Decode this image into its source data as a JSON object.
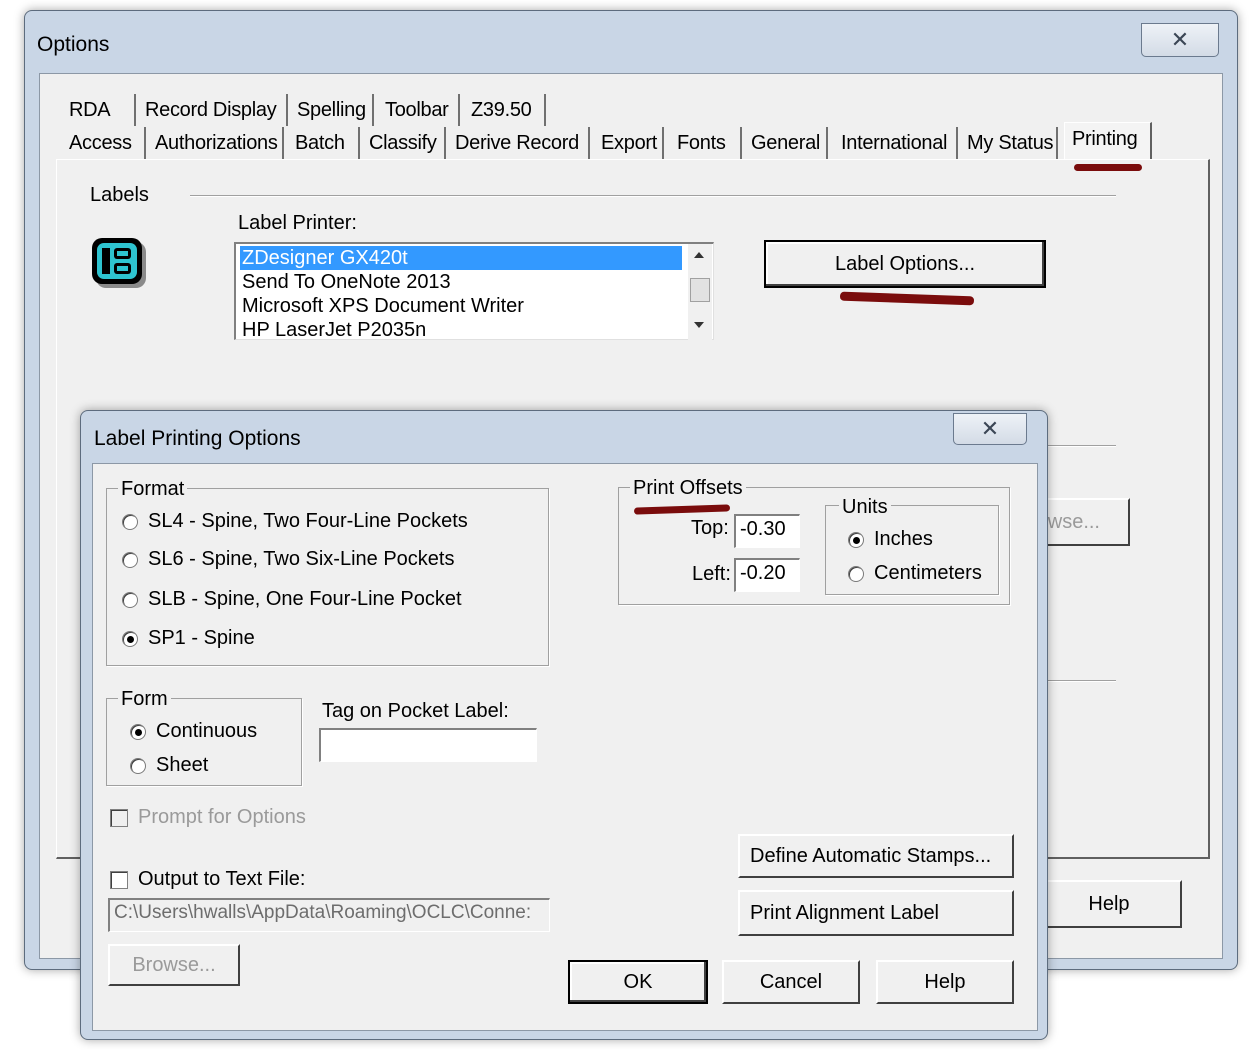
{
  "options_window": {
    "title": "Options",
    "close_glyph": "✕",
    "tabs_row1": [
      "RDA",
      "Record Display",
      "Spelling",
      "Toolbar",
      "Z39.50"
    ],
    "tabs_row2": [
      "Access",
      "Authorizations",
      "Batch",
      "Classify",
      "Derive Record",
      "Export",
      "Fonts",
      "General",
      "International",
      "My Status",
      "Printing"
    ],
    "active_tab": "Printing",
    "labels_section": "Labels",
    "label_printer_label": "Label Printer:",
    "printers": [
      "ZDesigner GX420t",
      "Send To OneNote 2013",
      "Microsoft XPS Document Writer",
      "HP LaserJet P2035n"
    ],
    "selected_printer": "ZDesigner GX420t",
    "label_options_button": "Label Options...",
    "browse_partial": "wse...",
    "help_button": "Help",
    "labels_icon": "label-printer-icon"
  },
  "label_dialog": {
    "title": "Label Printing Options",
    "close_glyph": "✕",
    "format_legend": "Format",
    "format_options": [
      "SL4 - Spine, Two Four-Line Pockets",
      "SL6 - Spine, Two Six-Line Pockets",
      "SLB - Spine, One Four-Line Pocket",
      "SP1 - Spine"
    ],
    "format_selected": "SP1 - Spine",
    "form_legend": "Form",
    "form_options": [
      "Continuous",
      "Sheet"
    ],
    "form_selected": "Continuous",
    "tag_label": "Tag on Pocket Label:",
    "tag_value": "",
    "prompt_label": "Prompt for Options",
    "output_label": "Output to Text File:",
    "output_path": "C:\\Users\\hwalls\\AppData\\Roaming\\OCLC\\Conne:",
    "browse_button": "Browse...",
    "offsets_legend": "Print Offsets",
    "top_label": "Top:",
    "top_value": "-0.30",
    "left_label": "Left:",
    "left_value": "-0.20",
    "units_legend": "Units",
    "units_options": [
      "Inches",
      "Centimeters"
    ],
    "units_selected": "Inches",
    "define_stamps_button": "Define Automatic Stamps...",
    "print_alignment_button": "Print Alignment Label",
    "ok_button": "OK",
    "cancel_button": "Cancel",
    "help_button": "Help"
  },
  "colors": {
    "annotation_marks": "#7a0c0c",
    "selection": "#3399ff",
    "frame": "#c9d6e6"
  }
}
